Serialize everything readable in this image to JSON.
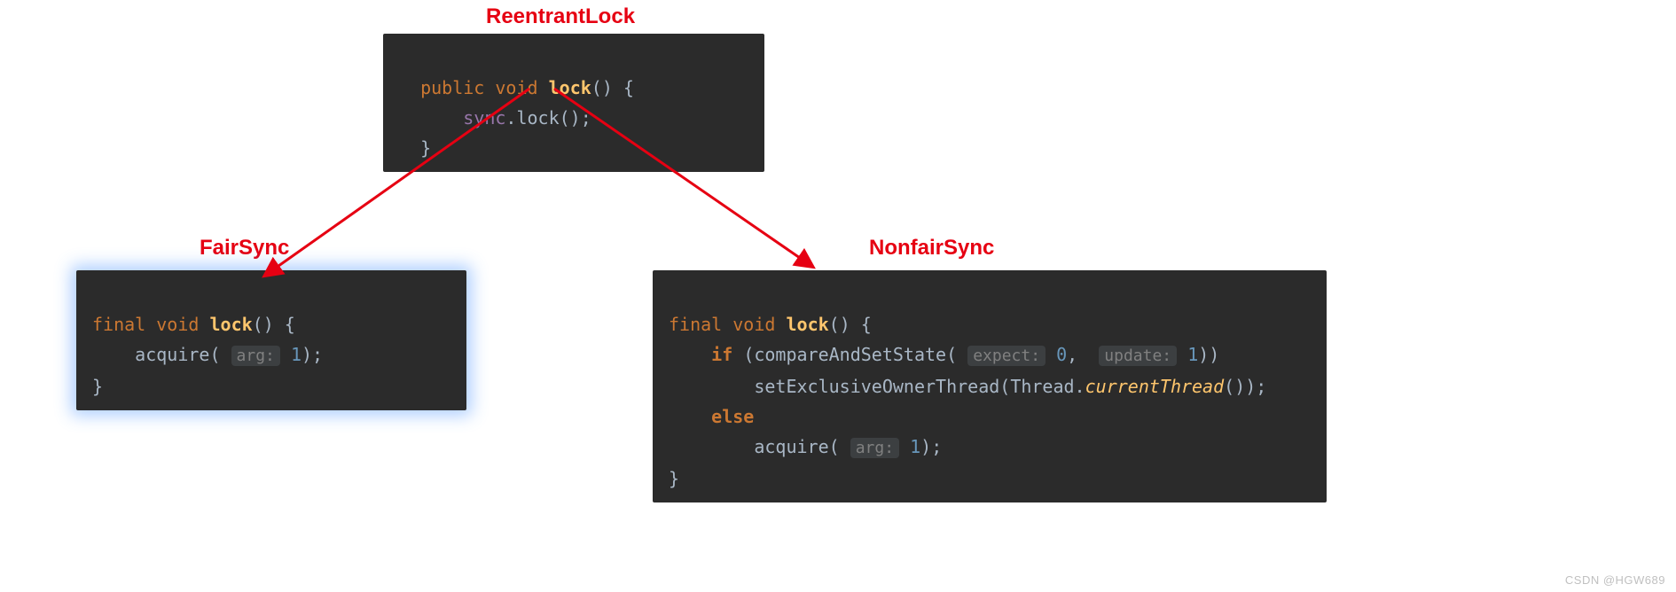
{
  "labels": {
    "top": "ReentrantLock",
    "left": "FairSync",
    "right": "NonfairSync"
  },
  "top_code": {
    "kw_public": "public",
    "kw_void": "void",
    "fn_lock": "lock",
    "parens_open": "() {",
    "sync_field": "sync",
    "dot_lock": ".lock();",
    "brace_close": "}"
  },
  "left_code": {
    "kw_final": "final",
    "kw_void": "void",
    "fn_lock": "lock",
    "parens_open": "() {",
    "acquire_call": "acquire(",
    "hint_arg": "arg:",
    "num_one": "1",
    "close": ");",
    "brace_close": "}"
  },
  "right_code": {
    "kw_final": "final",
    "kw_void": "void",
    "fn_lock": "lock",
    "parens_open": "() {",
    "kw_if": "if",
    "if_open": "(compareAndSetState(",
    "hint_expect": "expect:",
    "num_zero": "0",
    "comma": ",",
    "hint_update": "update:",
    "num_one": "1",
    "if_close": "))",
    "set_owner_open": "setExclusiveOwnerThread(Thread.",
    "current_thread": "currentThread",
    "set_owner_close": "());",
    "kw_else": "else",
    "acquire_call": "acquire(",
    "hint_arg": "arg:",
    "acq_close": ");",
    "brace_close": "}"
  },
  "watermark": "CSDN @HGW689"
}
